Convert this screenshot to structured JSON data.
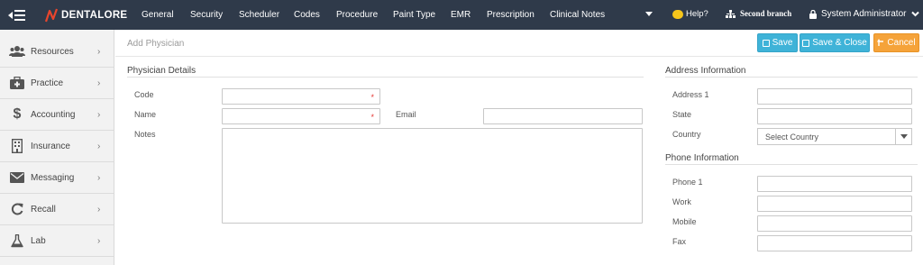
{
  "brand": {
    "name": "DENTALORE",
    "accent": "#e8452c"
  },
  "nav": {
    "items": [
      "General",
      "Security",
      "Scheduler",
      "Codes",
      "Procedure",
      "Paint Type",
      "EMR",
      "Prescription",
      "Clinical Notes"
    ],
    "help": "Help?",
    "branch": "Second branch",
    "user": "System Administrator"
  },
  "sidebar": {
    "items": [
      {
        "label": "Resources",
        "icon": "users-icon"
      },
      {
        "label": "Practice",
        "icon": "medkit-icon"
      },
      {
        "label": "Accounting",
        "icon": "dollar-icon"
      },
      {
        "label": "Insurance",
        "icon": "building-icon"
      },
      {
        "label": "Messaging",
        "icon": "envelope-icon"
      },
      {
        "label": "Recall",
        "icon": "refresh-icon"
      },
      {
        "label": "Lab",
        "icon": "flask-icon"
      }
    ]
  },
  "page": {
    "title": "Add Physician",
    "save_label": "Save",
    "save_close_label": "Save & Close",
    "cancel_label": "Cancel"
  },
  "physician": {
    "section": "Physician Details",
    "code_label": "Code",
    "name_label": "Name",
    "email_label": "Email",
    "notes_label": "Notes",
    "required_mark": "*"
  },
  "address": {
    "section": "Address Information",
    "address1_label": "Address 1",
    "state_label": "State",
    "country_label": "Country",
    "country_value": "Select Country"
  },
  "phone": {
    "section": "Phone Information",
    "phone1_label": "Phone 1",
    "work_label": "Work",
    "mobile_label": "Mobile",
    "fax_label": "Fax"
  },
  "colors": {
    "topbar": "#2f3a4a",
    "primary": "#3fb3d8",
    "warning": "#f5a33a",
    "required": "#e53935"
  }
}
